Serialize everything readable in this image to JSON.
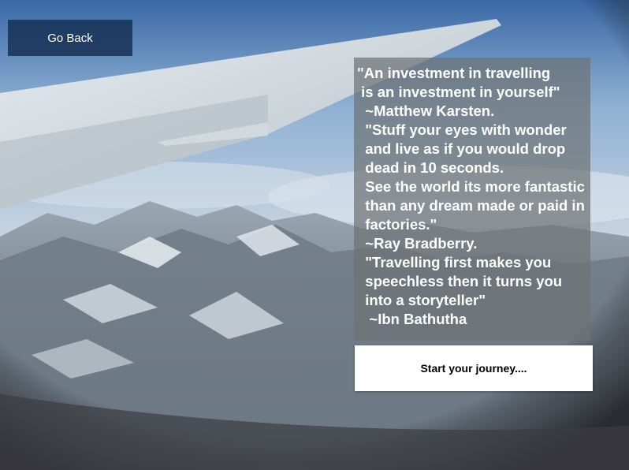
{
  "navigation": {
    "back_label": "Go Back"
  },
  "quotes": {
    "lines": [
      "\"An investment in travelling",
      " is an investment in yourself\"",
      "  ~Matthew Karsten.",
      "  \"Stuff your eyes with wonder",
      "  and live as if you would drop",
      "  dead in 10 seconds.",
      "  See the world its more fantastic",
      "  than any dream made or paid in",
      "  factories.\"",
      "  ~Ray Bradberry.",
      "  \"Travelling first makes you",
      "  speechless then it turns you",
      "  into a storyteller\"",
      "   ~Ibn Bathutha"
    ]
  },
  "cta": {
    "start_label": "Start your journey...."
  },
  "background": {
    "image_icon": "airplane-wing-mountains-photo"
  }
}
